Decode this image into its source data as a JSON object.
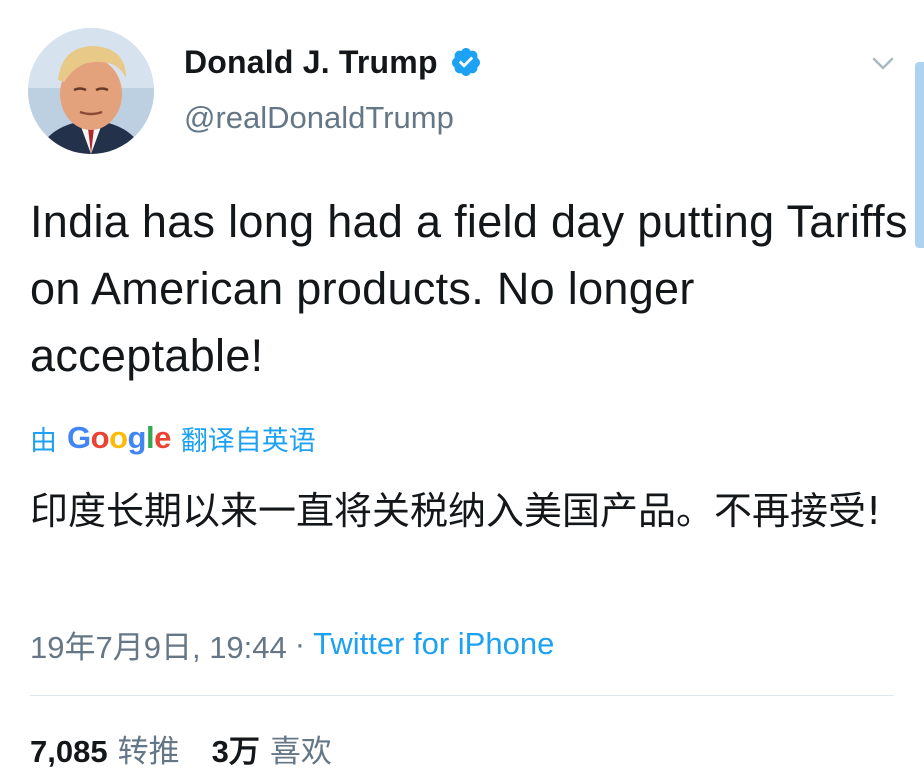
{
  "tweet": {
    "author": {
      "display_name": "Donald J. Trump",
      "handle": "@realDonaldTrump",
      "verified": true
    },
    "text": "India has long had a field day putting Tariffs on American products. No longer acceptable!",
    "translation": {
      "prefix": "由",
      "provider": "Google",
      "suffix": "翻译自英语",
      "text": "印度长期以来一直将关税纳入美国产品。不再接受!"
    },
    "meta": {
      "timestamp": "19年7月9日, 19:44",
      "separator": "·",
      "source": "Twitter for iPhone"
    },
    "stats": {
      "retweets_count": "7,085",
      "retweets_label": "转推",
      "likes_count": "3万",
      "likes_label": "喜欢"
    }
  },
  "colors": {
    "accent": "#1da1f2",
    "text_primary": "#14171a",
    "text_secondary": "#657786",
    "divider": "#e1e8ed"
  },
  "icons": {
    "avatar": "avatar-photo",
    "verified": "verified-badge-icon",
    "menu": "chevron-down-icon"
  }
}
